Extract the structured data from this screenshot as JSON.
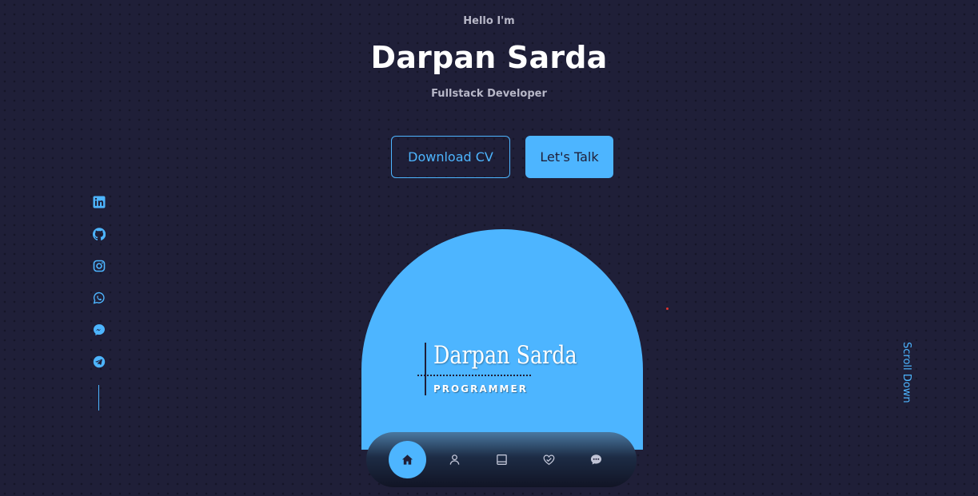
{
  "header": {
    "greeting": "Hello I'm",
    "name": "Darpan Sarda",
    "role": "Fullstack Developer"
  },
  "cta": {
    "download_label": "Download CV",
    "talk_label": "Let's Talk"
  },
  "socials": [
    {
      "icon": "linkedin-icon"
    },
    {
      "icon": "github-icon"
    },
    {
      "icon": "instagram-icon"
    },
    {
      "icon": "whatsapp-icon"
    },
    {
      "icon": "messenger-icon"
    },
    {
      "icon": "telegram-icon"
    }
  ],
  "portrait": {
    "signature_name": "Darpan Sarda",
    "signature_title": "PROGRAMMER"
  },
  "nav": {
    "items": [
      {
        "icon": "home-icon",
        "active": true
      },
      {
        "icon": "user-icon",
        "active": false
      },
      {
        "icon": "book-icon",
        "active": false
      },
      {
        "icon": "services-icon",
        "active": false
      },
      {
        "icon": "message-icon",
        "active": false
      }
    ]
  },
  "scroll_label": "Scroll Down",
  "colors": {
    "background": "#1f1f38",
    "primary": "#4db5ff",
    "text_light": "#b8b8c8",
    "accent_dot": "#e0342e"
  }
}
